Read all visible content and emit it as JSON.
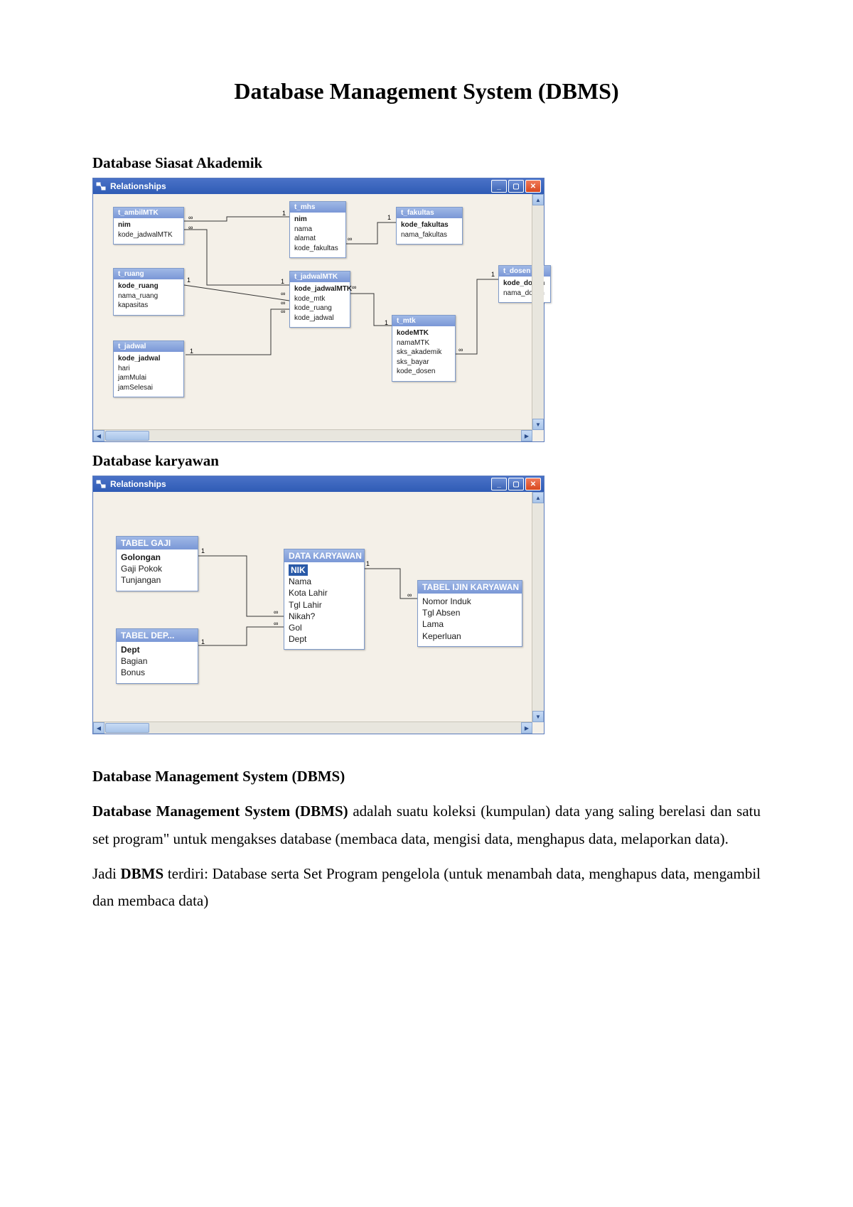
{
  "title": "Database Management System (DBMS)",
  "section1_heading": "Database Siasat Akademik",
  "section2_heading": "Database karyawan",
  "body_heading": "Database Management System (DBMS)",
  "body_para1_bold": "Database Management System (DBMS)",
  "body_para1_rest": " adalah suatu koleksi (kumpulan) data yang saling berelasi dan satu set program\" untuk mengakses database (membaca data, mengisi data, menghapus data, melaporkan data).",
  "body_para2_a": "Jadi ",
  "body_para2_bold": "DBMS",
  "body_para2_b": " terdiri: Database serta Set Program pengelola (untuk menambah data, menghapus data, mengambil dan membaca data)",
  "window": {
    "title": "Relationships",
    "icon_name": "relationships-icon"
  },
  "diagram1": {
    "tables": {
      "t_ambilMTK": {
        "title": "t_ambilMTK",
        "key": "nim",
        "fields": "kode_jadwalMTK"
      },
      "t_mhs": {
        "title": "t_mhs",
        "key": "nim",
        "fields": "nama\nalamat\nkode_fakultas"
      },
      "t_fakultas": {
        "title": "t_fakultas",
        "key": "kode_fakultas",
        "fields": "nama_fakultas"
      },
      "t_ruang": {
        "title": "t_ruang",
        "key": "kode_ruang",
        "fields": "nama_ruang\nkapasitas"
      },
      "t_jadwalMTK": {
        "title": "t_jadwalMTK",
        "key": "kode_jadwalMTK",
        "fields": "kode_mtk\nkode_ruang\nkode_jadwal"
      },
      "t_dosen": {
        "title": "t_dosen",
        "key": "kode_dosen",
        "fields": "nama_dosen"
      },
      "t_mtk": {
        "title": "t_mtk",
        "key": "kodeMTK",
        "fields": "namaMTK\nsks_akademik\nsks_bayar\nkode_dosen"
      },
      "t_jadwal": {
        "title": "t_jadwal",
        "key": "kode_jadwal",
        "fields": "hari\njamMulai\njamSelesai"
      }
    },
    "cardinality": {
      "one": "1",
      "many": "∞"
    }
  },
  "diagram2": {
    "tables": {
      "tabel_gaji": {
        "title": "TABEL GAJI",
        "key": "Golongan",
        "fields": "Gaji Pokok\nTunjangan"
      },
      "data_karyawan": {
        "title": "DATA KARYAWAN",
        "key": "NIK",
        "fields": "Nama\nKota Lahir\nTgl Lahir\nNikah?\nGol\nDept"
      },
      "tabel_dep": {
        "title": "TABEL DEP...",
        "key": "Dept",
        "fields": "Bagian\nBonus"
      },
      "tabel_ijin": {
        "title": "TABEL IJIN KARYAWAN",
        "key": "",
        "fields": "Nomor Induk\nTgl Absen\nLama\nKeperluan"
      }
    },
    "cardinality": {
      "one": "1",
      "many": "∞"
    }
  }
}
